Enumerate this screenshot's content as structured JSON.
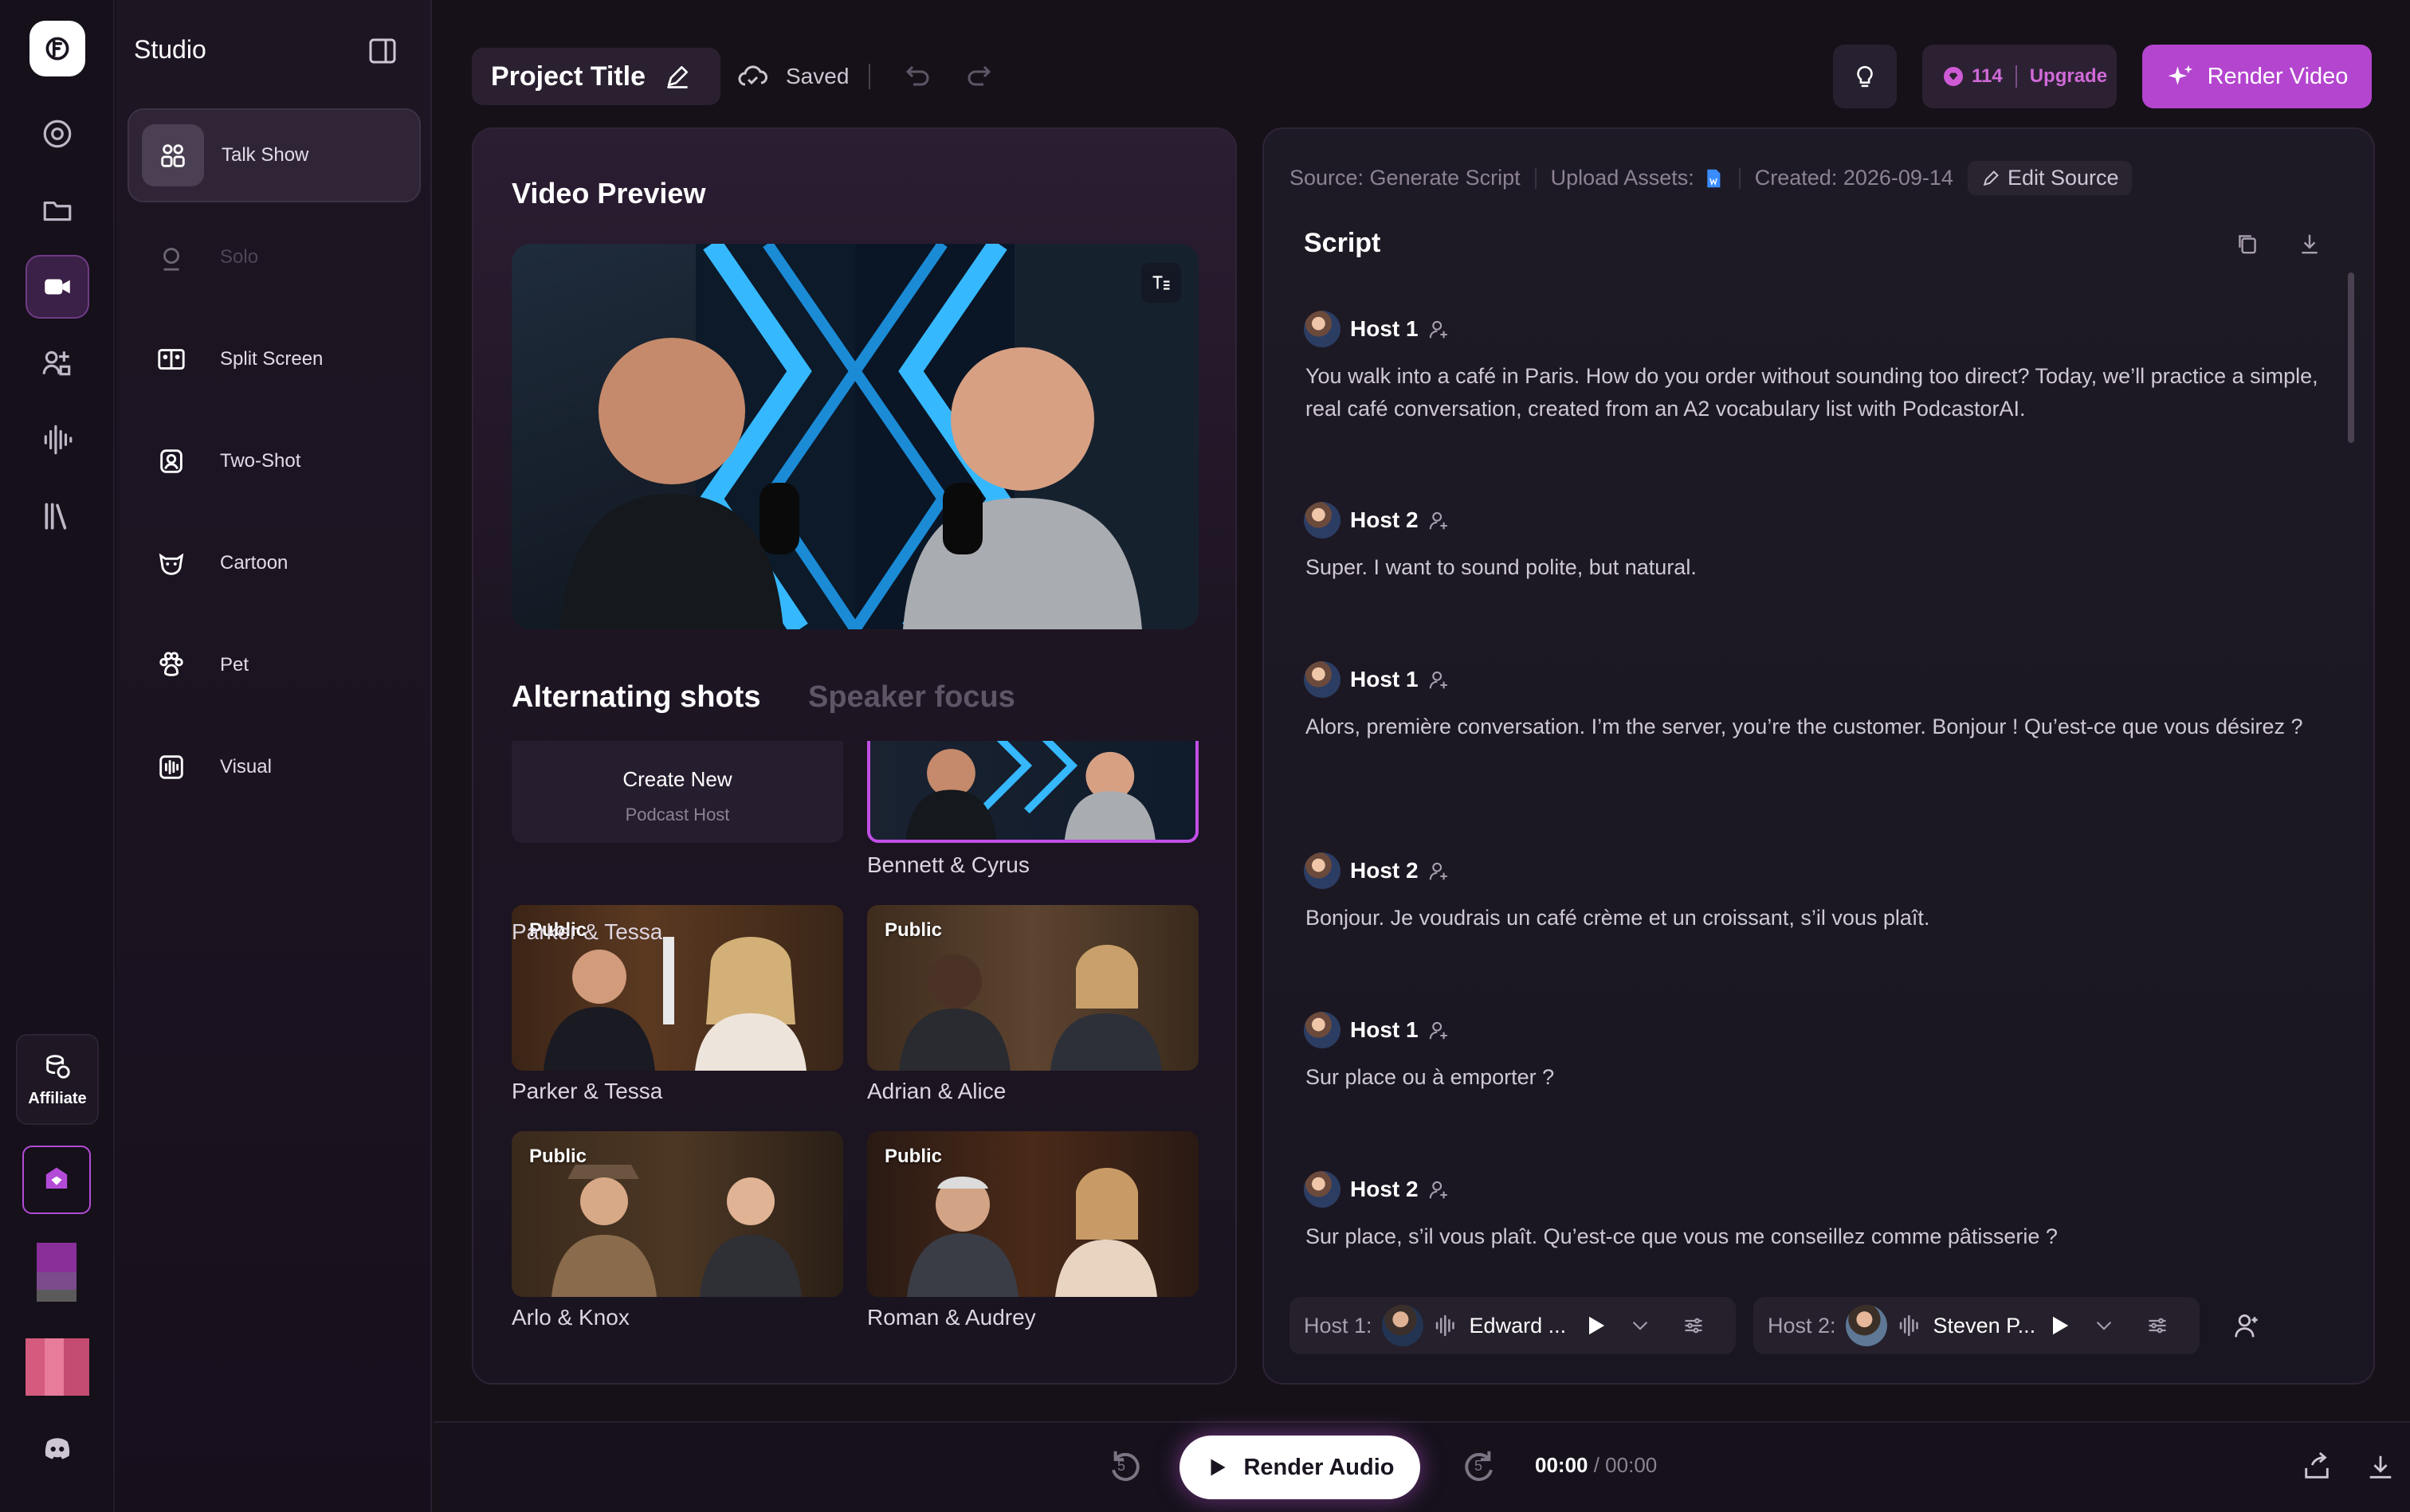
{
  "sidebar": {
    "affiliate_label": "Affiliate"
  },
  "studio": {
    "title": "Studio",
    "items": [
      {
        "label": "Talk Show",
        "state": "active"
      },
      {
        "label": "Solo",
        "state": "disabled"
      },
      {
        "label": "Split Screen",
        "state": "normal"
      },
      {
        "label": "Two-Shot",
        "state": "normal"
      },
      {
        "label": "Cartoon",
        "state": "normal"
      },
      {
        "label": "Pet",
        "state": "normal"
      },
      {
        "label": "Visual",
        "state": "normal"
      }
    ]
  },
  "header": {
    "project_title": "Project Title",
    "saved_label": "Saved",
    "credits": "114",
    "upgrade_label": "Upgrade",
    "render_video_label": "Render Video"
  },
  "preview": {
    "title": "Video Preview",
    "tabs": [
      {
        "label": "Alternating shots",
        "active": true
      },
      {
        "label": "Speaker focus",
        "active": false
      }
    ],
    "create_new": {
      "title": "Create New",
      "subtitle": "Podcast Host"
    },
    "hosts": [
      {
        "name": "Bennett & Cyrus",
        "tag": "",
        "selected": true
      },
      {
        "name": "Parker & Tessa",
        "tag": "Public"
      },
      {
        "name": "Adrian & Alice",
        "tag": "Public"
      },
      {
        "name": "Arlo & Knox",
        "tag": "Public"
      },
      {
        "name": "Roman & Audrey",
        "tag": "Public"
      }
    ]
  },
  "script": {
    "meta": {
      "source": "Source: Generate Script",
      "upload": "Upload Assets:",
      "created": "Created: 2026-09-14",
      "edit_source": "Edit Source"
    },
    "title": "Script",
    "lines": [
      {
        "speaker": "Host 1",
        "text": "You walk into a café in Paris. How do you order without sounding too direct? Today, we’ll practice a simple, real café conversation, created from an A2 vocabulary list with PodcastorAI."
      },
      {
        "speaker": "Host 2",
        "text": "Super. I want to sound polite, but natural."
      },
      {
        "speaker": "Host 1",
        "text": "Alors, première conversation. I’m the server, you’re the customer. Bonjour ! Qu’est-ce que vous désirez ?"
      },
      {
        "speaker": "Host 2",
        "text": "Bonjour. Je voudrais un café crème et un croissant, s’il vous plaît."
      },
      {
        "speaker": "Host 1",
        "text": "Sur place ou à emporter ?"
      },
      {
        "speaker": "Host 2",
        "text": "Sur place, s’il vous plaît. Qu’est-ce que vous me conseillez comme pâtisserie ?"
      }
    ],
    "voices": [
      {
        "label": "Host 1:",
        "voice": "Edward ..."
      },
      {
        "label": "Host 2:",
        "voice": "Steven P..."
      }
    ]
  },
  "player": {
    "render_audio_label": "Render Audio",
    "time_current": "00:00",
    "time_sep": " / ",
    "time_total": "00:00",
    "skip_back": "5",
    "skip_fwd": "5"
  }
}
